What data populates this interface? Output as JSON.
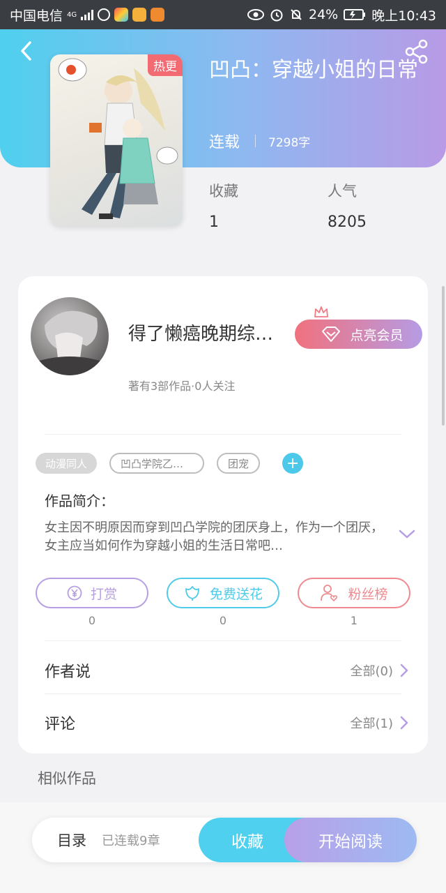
{
  "status_bar": {
    "carrier": "中国电信",
    "network": "4G",
    "battery": "24%",
    "time": "晚上10:43"
  },
  "book": {
    "hot_badge": "热更",
    "title": "凹凸：穿越小姐的日常",
    "status": "连载",
    "word_count": "7298字",
    "favorites_label": "收藏",
    "favorites_value": "1",
    "popularity_label": "人气",
    "popularity_value": "8205"
  },
  "author": {
    "name": "得了懒癌晚期综…",
    "vip_button": "点亮会员",
    "meta": "著有3部作品·0人关注"
  },
  "tags": [
    "动漫同人",
    "凹凸学院乙…",
    "团宠"
  ],
  "intro": {
    "label": "作品简介：",
    "text": "女主因不明原因而穿到凹凸学院的团厌身上，作为一个团厌，女主应当如何作为穿越小姐的生活日常吧…"
  },
  "actions": [
    {
      "label": "打赏",
      "count": "0",
      "color": "#b59ee2"
    },
    {
      "label": "免费送花",
      "count": "0",
      "color": "#4fcbe9"
    },
    {
      "label": "粉丝榜",
      "count": "1",
      "color": "#ee8a8f"
    }
  ],
  "sections": {
    "author_says_label": "作者说",
    "author_says_link": "全部(0)",
    "comments_label": "评论",
    "comments_link": "全部(1)",
    "similar_label": "相似作品"
  },
  "bottom_bar": {
    "toc": "目录",
    "chapters": "已连载9章",
    "favorite": "收藏",
    "read": "开始阅读"
  },
  "colors": {
    "accent_cyan": "#4fd0ee",
    "accent_purple": "#b89ae6",
    "hot_red": "#f26b73"
  }
}
